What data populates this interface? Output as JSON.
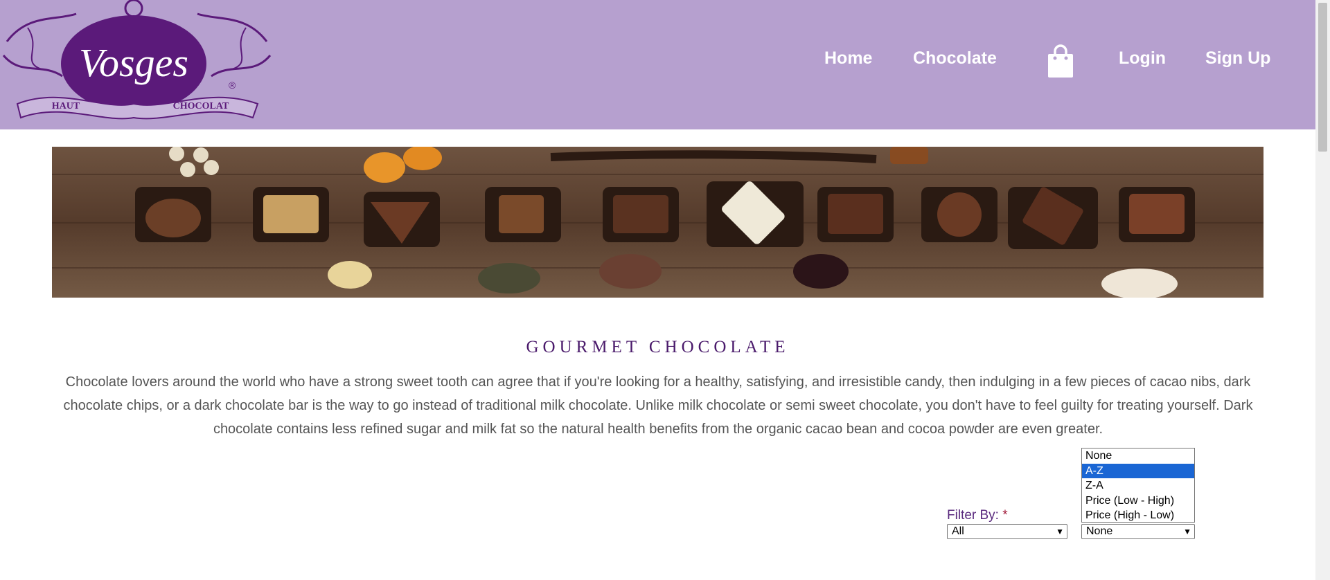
{
  "logo": {
    "brand": "Vosges",
    "line_left": "HAUT",
    "line_right": "CHOCOLAT",
    "mark": "®"
  },
  "nav": {
    "items": [
      "Home",
      "Chocolate",
      "Login",
      "Sign Up"
    ],
    "cart_icon": "shopping-bag-icon"
  },
  "main": {
    "title": "GOURMET CHOCOLATE",
    "description": "Chocolate lovers around the world who have a strong sweet tooth can agree that if you're looking for a healthy, satisfying, and irresistible candy, then indulging in a few pieces of cacao nibs, dark chocolate chips, or a dark chocolate bar is the way to go instead of traditional milk chocolate. Unlike milk chocolate or semi sweet chocolate, you don't have to feel guilty for treating yourself. Dark chocolate contains less refined sugar and milk fat so the natural health benefits from the organic cacao bean and cocoa powder are even greater."
  },
  "filter": {
    "label": "Filter By:",
    "required_mark": "*",
    "category_value": "All",
    "sort_value": "None",
    "sort_options": [
      "None",
      "A-Z",
      "Z-A",
      "Price (Low - High)",
      "Price (High - Low)"
    ],
    "highlighted_option": "A-Z"
  },
  "colors": {
    "header_bg": "#b6a0cf",
    "logo_purple": "#5b1a7a",
    "title": "#4a1a6b",
    "highlight": "#1a66d4"
  }
}
